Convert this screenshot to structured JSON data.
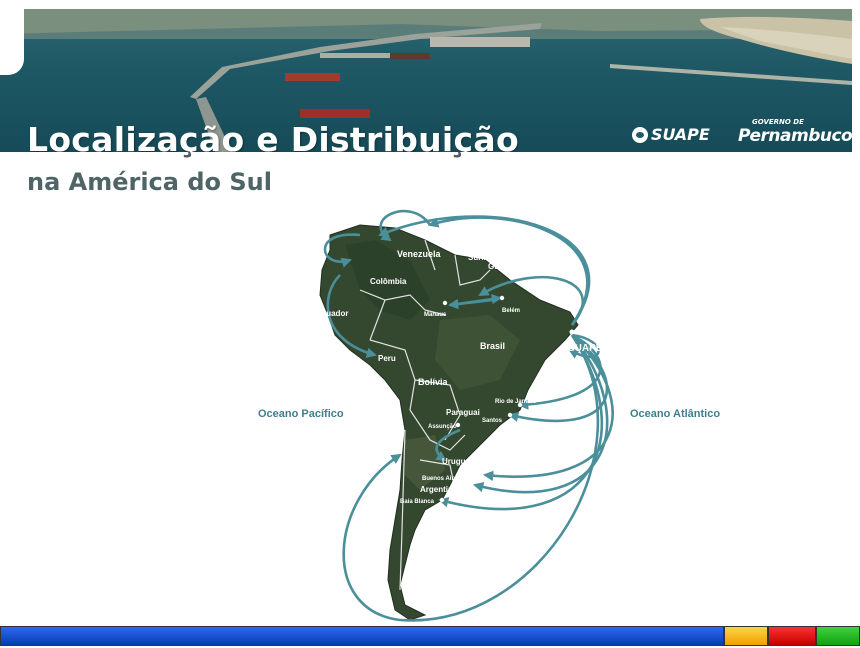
{
  "header": {
    "title_line1": "Localização e Distribuição",
    "title_line2": "na América do Sul"
  },
  "logos": {
    "suape": "SUAPE",
    "governo_small": "GOVERNO DE",
    "governo_big": "Pernambuco"
  },
  "map": {
    "ocean_pacific": "Oceano Pacífico",
    "ocean_atlantic": "Oceano Atlântico",
    "hub_label": "SUAPE",
    "countries": {
      "venezuela": "Venezuela",
      "guiana": "Guiana",
      "suriname": "Suriname",
      "guiana_francesa": "Guiana Francesa",
      "colombia": "Colômbia",
      "equador": "Equador",
      "peru": "Peru",
      "brasil": "Brasil",
      "bolivia": "Bolívia",
      "paraguai": "Paraguai",
      "chile": "Chile",
      "uruguai": "Uruguai",
      "argentina": "Argentina"
    },
    "cities": {
      "manaus": "Manaus",
      "belem": "Belém",
      "rio": "Rio de Janeiro",
      "santos": "Santos",
      "assuncao": "Assunção",
      "montevideu": "Montevidéu",
      "buenos_aires": "Buenos Aires",
      "bahia_blanca": "Baía Blanca"
    },
    "route_color": "#4a8f9a",
    "land_color": "#33482f"
  },
  "footer_colors": [
    "#1148c8",
    "#f5b400",
    "#d81010",
    "#28b428"
  ]
}
